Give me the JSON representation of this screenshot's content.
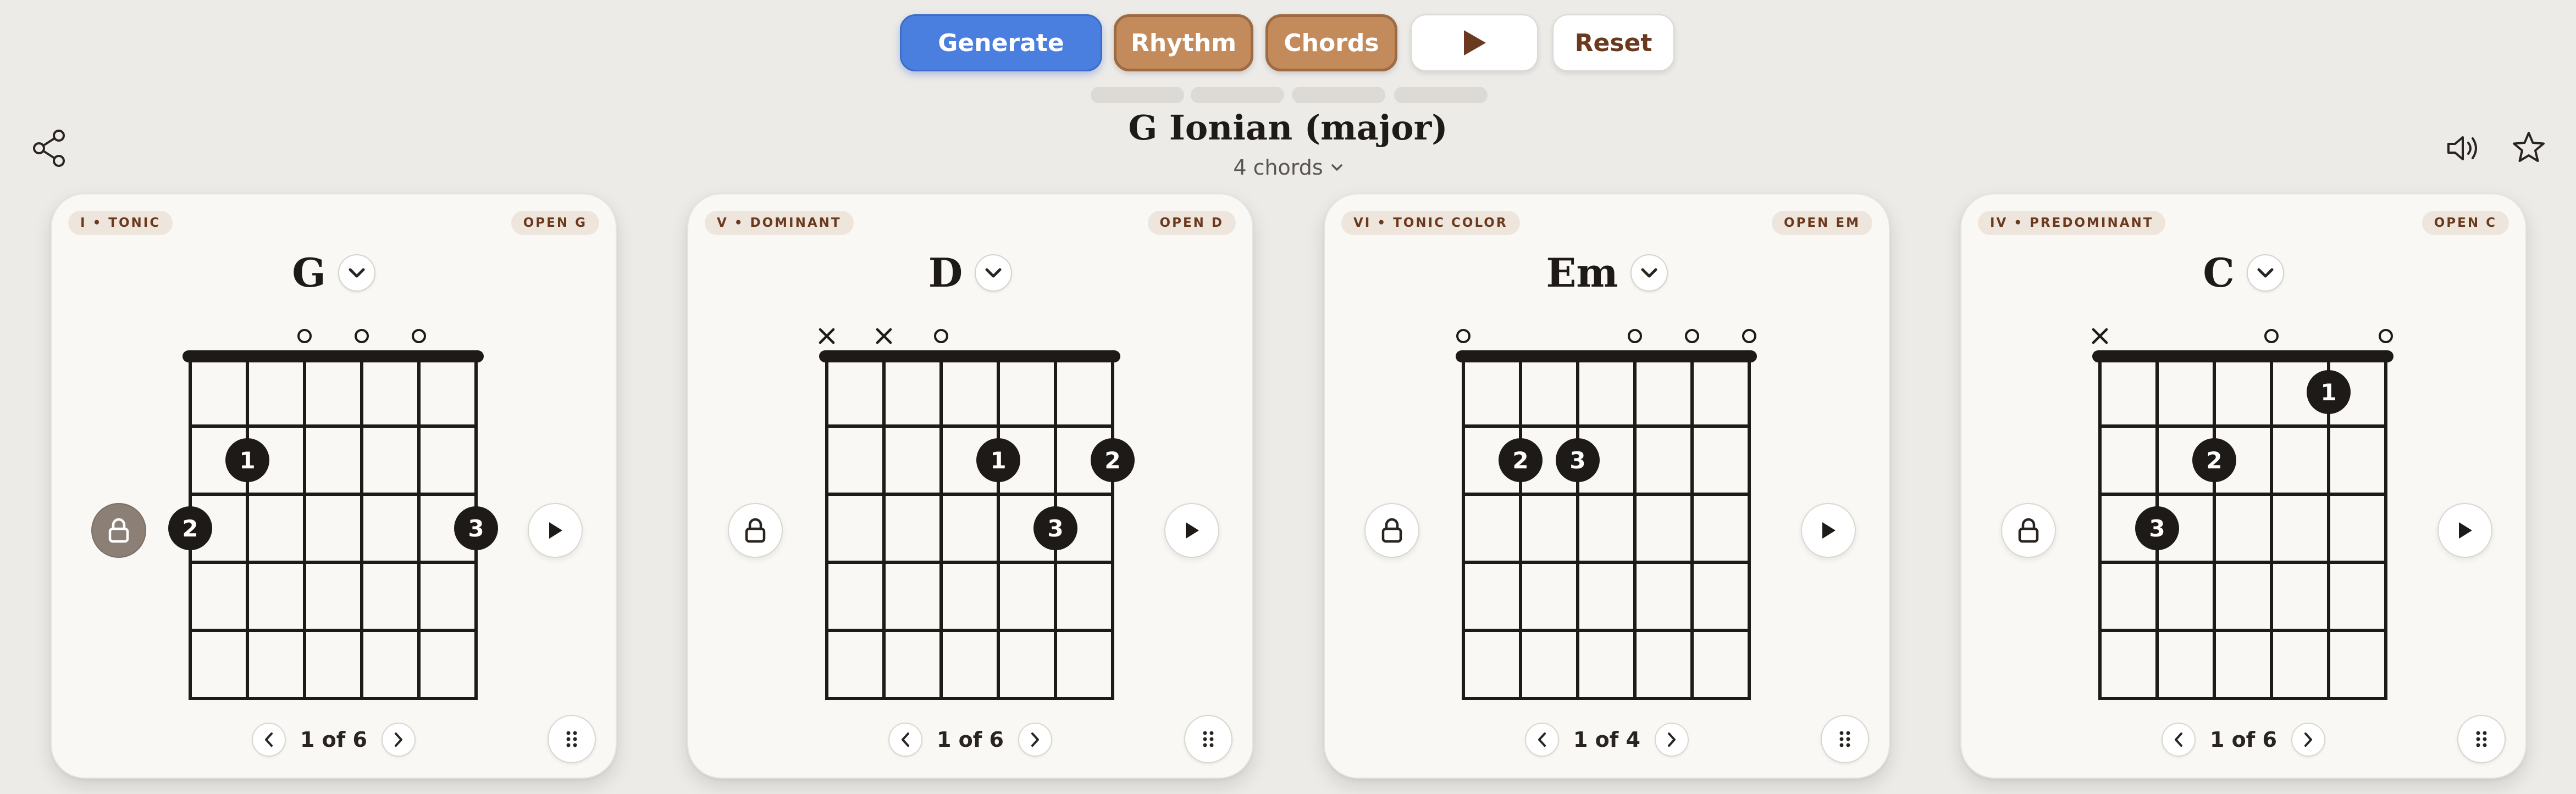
{
  "toolbar": {
    "generate_label": "Generate",
    "rhythm_label": "Rhythm",
    "chords_label": "Chords",
    "play_icon": "play-icon",
    "reset_label": "Reset"
  },
  "header": {
    "title": "G Ionian (major)",
    "chord_count": "4 chords"
  },
  "colors": {
    "accent_blue": "#4a7fe0",
    "accent_brown": "#c38a5b",
    "badge_text": "#6b3a1e",
    "background": "#ecebe8",
    "card": "#f9f8f5"
  },
  "cards": [
    {
      "role": "I • TONIC",
      "voicing": "OPEN G",
      "name": "G",
      "locked": true,
      "page": "1 of 6",
      "strings": [
        "",
        "",
        "o",
        "o",
        "o",
        ""
      ],
      "fingers": [
        {
          "string": 2,
          "fret": 2,
          "label": "1"
        },
        {
          "string": 1,
          "fret": 3,
          "label": "2"
        },
        {
          "string": 6,
          "fret": 3,
          "label": "3"
        }
      ]
    },
    {
      "role": "V • DOMINANT",
      "voicing": "OPEN D",
      "name": "D",
      "locked": false,
      "page": "1 of 6",
      "strings": [
        "x",
        "x",
        "o",
        "",
        "",
        ""
      ],
      "fingers": [
        {
          "string": 4,
          "fret": 2,
          "label": "1"
        },
        {
          "string": 6,
          "fret": 2,
          "label": "2"
        },
        {
          "string": 5,
          "fret": 3,
          "label": "3"
        }
      ]
    },
    {
      "role": "VI • TONIC COLOR",
      "voicing": "OPEN EM",
      "name": "Em",
      "locked": false,
      "page": "1 of 4",
      "strings": [
        "o",
        "",
        "",
        "o",
        "o",
        "o"
      ],
      "fingers": [
        {
          "string": 2,
          "fret": 2,
          "label": "2"
        },
        {
          "string": 3,
          "fret": 2,
          "label": "3"
        }
      ]
    },
    {
      "role": "IV • PREDOMINANT",
      "voicing": "OPEN C",
      "name": "C",
      "locked": false,
      "page": "1 of 6",
      "strings": [
        "x",
        "",
        "",
        "o",
        "",
        "o"
      ],
      "fingers": [
        {
          "string": 5,
          "fret": 1,
          "label": "1"
        },
        {
          "string": 3,
          "fret": 2,
          "label": "2"
        },
        {
          "string": 2,
          "fret": 3,
          "label": "3"
        }
      ]
    }
  ]
}
